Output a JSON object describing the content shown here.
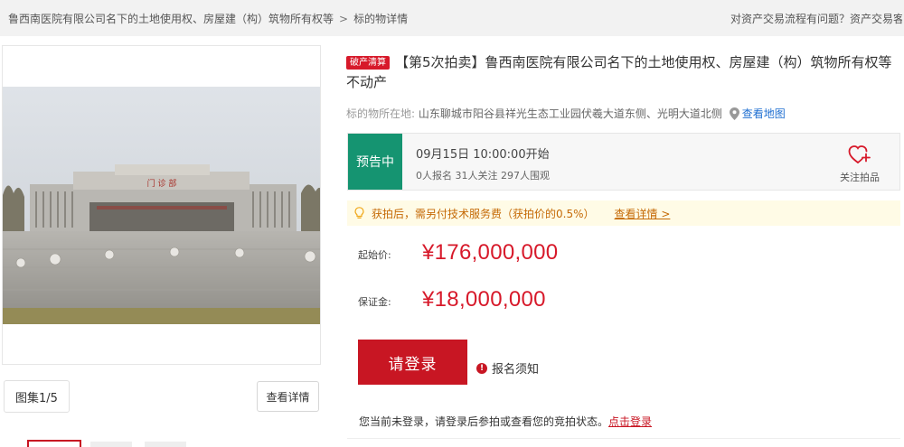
{
  "breadcrumb": {
    "item1": "鲁西南医院有限公司名下的土地使用权、房屋建（构）筑物所有权等",
    "separator": ">",
    "item2": "标的物详情"
  },
  "header": {
    "help_text": "对资产交易流程有问题？资产交易客"
  },
  "gallery": {
    "counter": "图集1/5",
    "detail_button": "查看详情",
    "photo_sign": "门  诊  部"
  },
  "item": {
    "tag": "破产清算",
    "title": "【第5次拍卖】鲁西南医院有限公司名下的土地使用权、房屋建（构）筑物所有权等不动产",
    "location_label": "标的物所在地:",
    "address": "山东聊城市阳谷县祥光生态工业园伏羲大道东侧、光明大道北侧",
    "map_link": "查看地图"
  },
  "auction": {
    "status": "预告中",
    "start_time": "09月15日 10:00:00开始",
    "stats": "0人报名  31人关注  297人围观",
    "follow_label": "关注拍品"
  },
  "notice": {
    "text": "获拍后，需另付技术服务费（获拍价的0.5%）",
    "link": "查看详情 >"
  },
  "prices": {
    "start_label": "起始价:",
    "start_value": "¥176,000,000",
    "deposit_label": "保证金:",
    "deposit_value": "¥18,000,000"
  },
  "actions": {
    "login_button": "请登录",
    "signup_notes": "报名须知",
    "login_hint": "您当前未登录，请登录后参拍或查看您的竞拍状态。",
    "login_link": "点击登录"
  },
  "colors": {
    "brand_red": "#c81623",
    "status_green": "#159471",
    "notice_bg": "#fffbe6",
    "link_blue": "#1f6fd1"
  },
  "icons": [
    "bulb-icon",
    "map-pin-icon",
    "heart-plus-icon",
    "exclamation-icon"
  ]
}
